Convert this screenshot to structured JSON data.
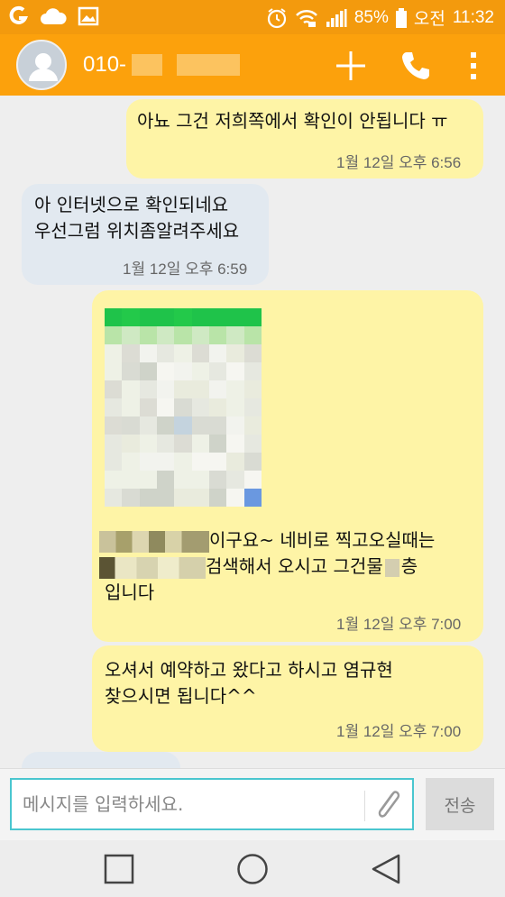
{
  "status_bar": {
    "battery": "85%",
    "ampm": "오전",
    "time": "11:32",
    "icons": [
      "carrier-icon",
      "cloud-icon",
      "gallery-icon",
      "alarm-icon",
      "wifi-icon",
      "signal-icon",
      "battery-icon"
    ]
  },
  "header": {
    "contact_prefix": "010-",
    "actions": [
      "add-icon",
      "phone-icon",
      "more-icon"
    ],
    "color": "#fca10c"
  },
  "messages": [
    {
      "direction": "outgoing",
      "lines": [
        "아뇨 그건 저희쪽에서 확인이 안됩니다 ㅠ"
      ],
      "time": "1월 12일 오후 6:56"
    },
    {
      "direction": "incoming",
      "lines": [
        "아 인터넷으로 확인되네요",
        "우선그럼 위치좀알려주세요"
      ],
      "time": "1월 12일 오후 6:59"
    },
    {
      "direction": "outgoing",
      "has_image": true,
      "line1": "이구요~ 네비로 찍고오실때는",
      "line2a": "검색해서 오시고 그건물",
      "line2b": "층",
      "line3": "입니다",
      "time": "1월 12일 오후 7:00"
    },
    {
      "direction": "outgoing",
      "lines": [
        "오셔서 예약하고 왔다고 하시고 염규현",
        "찾으시면 됩니다^^"
      ],
      "time": "1월 12일 오후 7:00"
    }
  ],
  "composer": {
    "placeholder": "메시지를 입력하세요.",
    "send_label": "전송"
  },
  "colors": {
    "outgoing_bubble": "#fef4a6",
    "incoming_bubble": "#e2e9f0",
    "status_bar": "#f39a0d",
    "input_border": "#4ac6cf"
  }
}
